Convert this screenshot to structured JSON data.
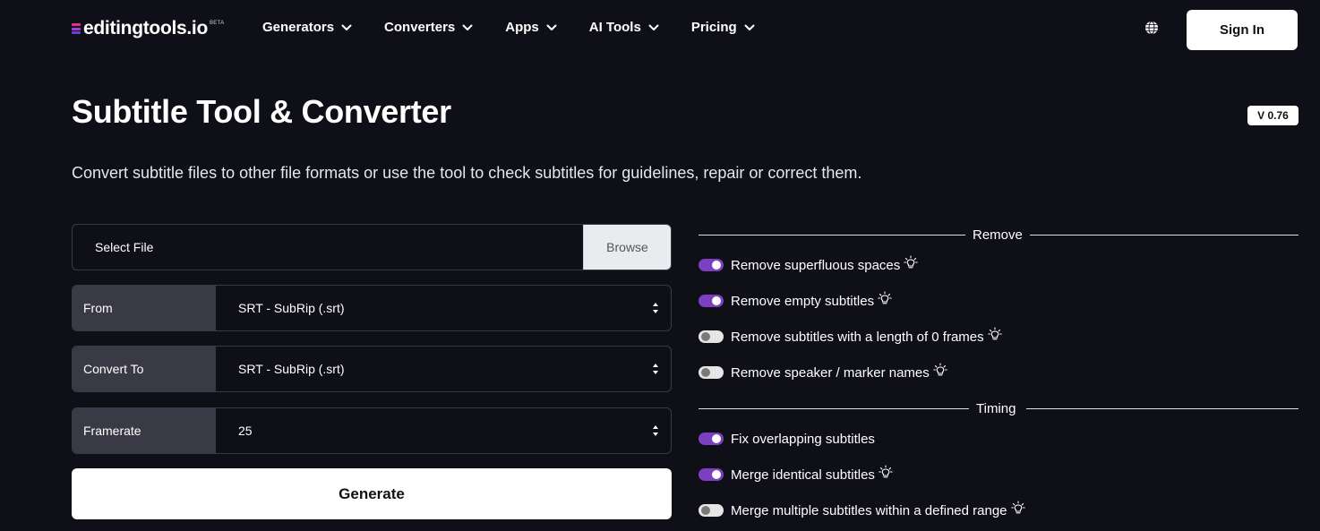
{
  "nav": {
    "logo_text": "editingtools.io",
    "logo_badge": "BETA",
    "menu": [
      {
        "label": "Generators"
      },
      {
        "label": "Converters"
      },
      {
        "label": "Apps"
      },
      {
        "label": "AI Tools"
      },
      {
        "label": "Pricing"
      }
    ],
    "globe_icon": "globe-icon",
    "signin_label": "Sign In"
  },
  "header": {
    "title": "Subtitle Tool & Converter",
    "version": "V 0.76",
    "description": "Convert subtitle files to other file formats or use the tool to check subtitles for guidelines, repair or correct them."
  },
  "form": {
    "file_label": "Select File",
    "browse_label": "Browse",
    "from": {
      "label": "From",
      "value": "SRT - SubRip (.srt)"
    },
    "convert_to": {
      "label": "Convert To",
      "value": "SRT - SubRip (.srt)"
    },
    "framerate": {
      "label": "Framerate",
      "value": "25"
    },
    "generate_label": "Generate"
  },
  "options": {
    "remove": {
      "heading": "Remove",
      "items": [
        {
          "label": "Remove superfluous spaces",
          "on": true,
          "hint": true
        },
        {
          "label": "Remove empty subtitles",
          "on": true,
          "hint": true
        },
        {
          "label": "Remove subtitles with a length of 0 frames",
          "on": false,
          "hint": true
        },
        {
          "label": "Remove speaker / marker names",
          "on": false,
          "hint": true
        }
      ]
    },
    "timing": {
      "heading": "Timing",
      "items": [
        {
          "label": "Fix overlapping subtitles",
          "on": true,
          "hint": false
        },
        {
          "label": "Merge identical subtitles",
          "on": true,
          "hint": true
        },
        {
          "label": "Merge multiple subtitles within a defined range",
          "on": false,
          "hint": true
        }
      ]
    }
  },
  "colors": {
    "background": "#0f0f17",
    "accent": "#7b3fbf",
    "input_label_bg": "#3a3a46"
  }
}
